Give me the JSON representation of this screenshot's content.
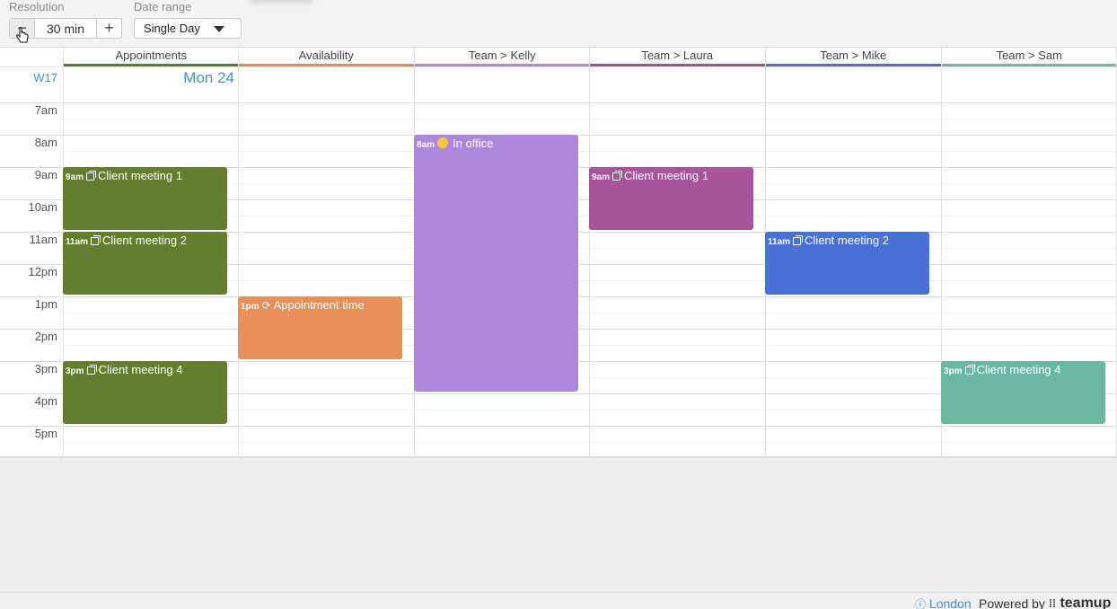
{
  "toolbar": {
    "resolution_label": "Resolution",
    "resolution_value": "30 min",
    "minus_label": "−",
    "plus_label": "+",
    "date_range_label": "Date range",
    "date_range_value": "Single Day"
  },
  "calendar": {
    "week": "W17",
    "day": "Mon 24",
    "columns": [
      {
        "label": "Appointments",
        "color": "#5b7d2c"
      },
      {
        "label": "Availability",
        "color": "#e8894a"
      },
      {
        "label": "Team > Kelly",
        "color": "#ad87e0"
      },
      {
        "label": "Team > Laura",
        "color": "#a34f9a"
      },
      {
        "label": "Team > Mike",
        "color": "#4a6fd6"
      },
      {
        "label": "Team > Sam",
        "color": "#6bb9a3"
      }
    ],
    "times": [
      "7am",
      "8am",
      "9am",
      "10am",
      "11am",
      "12pm",
      "1pm",
      "2pm",
      "3pm",
      "4pm",
      "5pm"
    ],
    "events": [
      {
        "col": 0,
        "time": "9am",
        "title": "Client meeting 1",
        "color": "#617f2e",
        "icon": "copy"
      },
      {
        "col": 0,
        "time": "11am",
        "title": "Client meeting 2",
        "color": "#617f2e",
        "icon": "copy"
      },
      {
        "col": 0,
        "time": "3pm",
        "title": "Client meeting 4",
        "color": "#617f2e",
        "icon": "copy"
      },
      {
        "col": 1,
        "time": "1pm",
        "title": "Appointment time",
        "color": "#e8905a",
        "icon": "repeat"
      },
      {
        "col": 2,
        "time": "8am",
        "title": "In office",
        "color": "#ad87dc",
        "icon": "smile"
      },
      {
        "col": 3,
        "time": "9am",
        "title": "Client meeting 1",
        "color": "#a8549c",
        "icon": "copy"
      },
      {
        "col": 4,
        "time": "11am",
        "title": "Client meeting 2",
        "color": "#4a72d6",
        "icon": "copy"
      },
      {
        "col": 5,
        "time": "3pm",
        "title": "Client meeting 4",
        "color": "#6bb8a2",
        "icon": "copy"
      }
    ]
  },
  "footer": {
    "timezone": "London",
    "powered_by": "Powered by",
    "brand": "teamup"
  }
}
